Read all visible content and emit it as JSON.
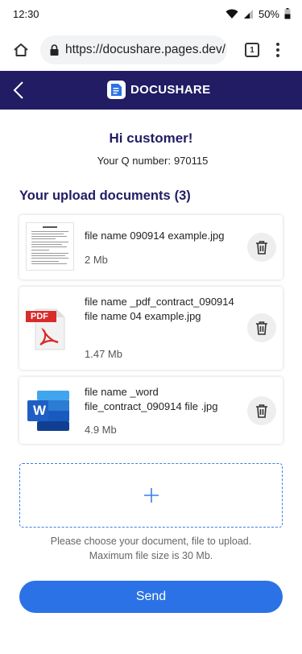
{
  "status_bar": {
    "time": "12:30",
    "battery": "50%"
  },
  "browser": {
    "url": "https://docushare.pages.dev/",
    "tab_count": "1"
  },
  "header": {
    "brand": "DOCUSHARE"
  },
  "greeting": {
    "title": "Hi customer!",
    "q_label": "Your Q number:",
    "q_value": "970115"
  },
  "uploads": {
    "title": "Your upload documents",
    "count": "(3)",
    "items": [
      {
        "name": "file name 090914 example.jpg",
        "size": "2 Mb",
        "icon": "document-thumbnail"
      },
      {
        "name": "file name _pdf_contract_090914 file name 04 example.jpg",
        "size": "1.47 Mb",
        "icon": "pdf-icon",
        "badge": "PDF"
      },
      {
        "name": "file name _word file_contract_090914 file .jpg",
        "size": "4.9 Mb",
        "icon": "word-icon",
        "badge": "W"
      }
    ]
  },
  "hint": {
    "line1": "Please choose your document, file to upload.",
    "line2": "Maximum file size is 30 Mb."
  },
  "send_label": "Send",
  "colors": {
    "header_bg": "#221c64",
    "accent_text": "#221c64",
    "primary_button": "#2b72e6",
    "dropzone_border": "#3d7cf0",
    "pdf_red": "#d92b2b",
    "word_blue": "#1f5fc4"
  }
}
